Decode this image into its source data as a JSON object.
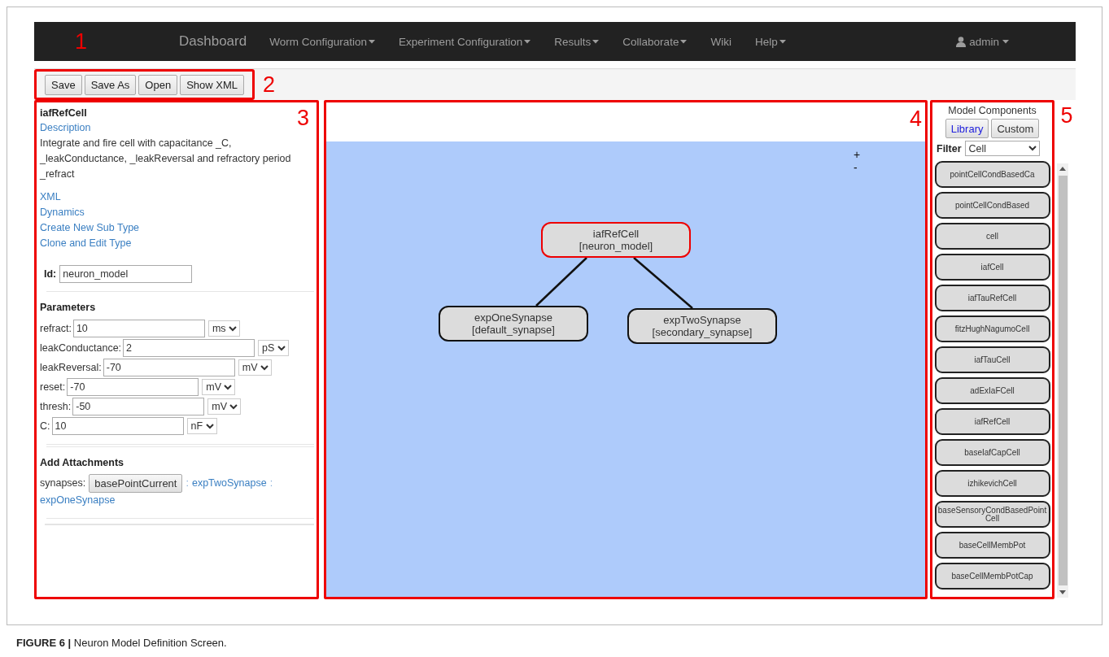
{
  "navbar": {
    "marker": "1",
    "brand": "Dashboard",
    "menus": [
      {
        "label": "Worm Configuration",
        "dropdown": true
      },
      {
        "label": "Experiment Configuration",
        "dropdown": true
      },
      {
        "label": "Results",
        "dropdown": true
      },
      {
        "label": "Collaborate",
        "dropdown": true
      },
      {
        "label": "Wiki",
        "dropdown": false
      },
      {
        "label": "Help",
        "dropdown": true
      }
    ],
    "user": {
      "label": "admin",
      "dropdown": true
    }
  },
  "toolbar": {
    "marker": "2",
    "buttons": [
      "Save",
      "Save As",
      "Open",
      "Show XML"
    ]
  },
  "details": {
    "marker": "3",
    "title": "iafRefCell",
    "description_link": "Description",
    "description": "Integrate and fire cell with capacitance _C, _leakConductance, _leakReversal and refractory period _refract",
    "links": [
      "XML",
      "Dynamics",
      "Create New Sub Type",
      "Clone and Edit Type"
    ],
    "id": {
      "label": "Id:",
      "value": "neuron_model"
    },
    "parameters": {
      "heading": "Parameters",
      "rows": [
        {
          "label": "refract:",
          "value": "10",
          "unit": "ms"
        },
        {
          "label": "leakConductance:",
          "value": "2",
          "unit": "pS"
        },
        {
          "label": "leakReversal:",
          "value": "-70",
          "unit": "mV"
        },
        {
          "label": "reset:",
          "value": "-70",
          "unit": "mV"
        },
        {
          "label": "thresh:",
          "value": "-50",
          "unit": "mV"
        },
        {
          "label": "C:",
          "value": "10",
          "unit": "nF"
        }
      ]
    },
    "attachments": {
      "heading": "Add Attachments",
      "label": "synapses:",
      "button": "basePointCurrent",
      "parts": [
        {
          "kind": "separator",
          "text": ":"
        },
        {
          "kind": "link",
          "text": "expTwoSynapse"
        },
        {
          "kind": "separator",
          "text": ":"
        },
        {
          "kind": "link",
          "text": "expOneSynapse"
        }
      ]
    }
  },
  "canvas": {
    "marker": "4",
    "zoom_controls": [
      "+",
      "-"
    ],
    "root": {
      "name": "iafRefCell",
      "id": "[neuron_model]",
      "selected": true,
      "children": [
        {
          "name": "expOneSynapse",
          "id": "[default_synapse]",
          "selected": false
        },
        {
          "name": "expTwoSynapse",
          "id": "[secondary_synapse]",
          "selected": false
        }
      ]
    }
  },
  "palette": {
    "marker": "5",
    "title": "Model Components",
    "tabs": [
      {
        "label": "Library",
        "selected": true
      },
      {
        "label": "Custom",
        "selected": false
      }
    ],
    "filter": {
      "label": "Filter",
      "value": "Cell"
    },
    "items": [
      "pointCellCondBasedCa",
      "pointCellCondBased",
      "cell",
      "iafCell",
      "iafTauRefCell",
      "fitzHughNagumoCell",
      "iafTauCell",
      "adExIaFCell",
      "iafRefCell",
      "baseIafCapCell",
      "izhikevichCell",
      "baseSensoryCondBasedPointCell",
      "baseCellMembPot",
      "baseCellMembPotCap"
    ]
  },
  "caption": "**FIGURE 6 |** Neuron Model Definition Screen."
}
